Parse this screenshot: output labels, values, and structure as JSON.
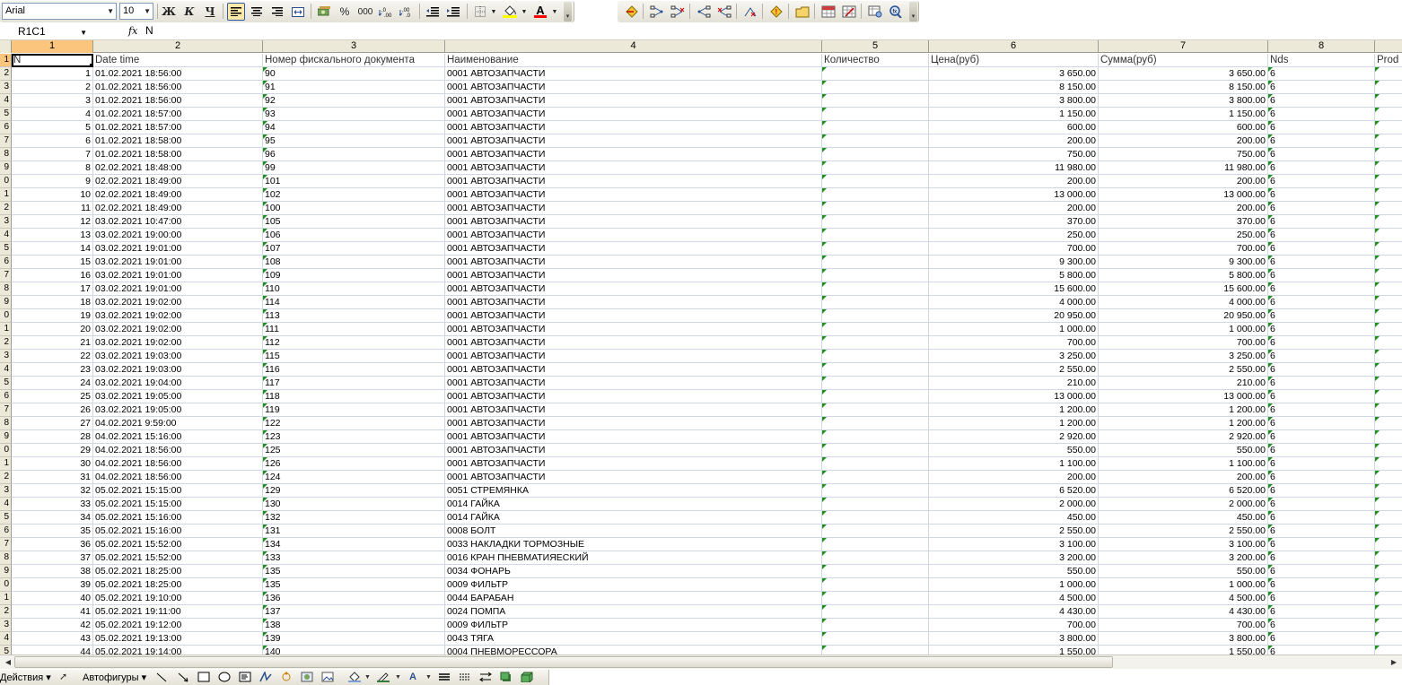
{
  "toolbar": {
    "font_name": "Arial",
    "font_size": "10",
    "bold_label": "Ж",
    "italic_label": "К",
    "underline_label": "Ч",
    "percent_label": "%",
    "thousands_label": "000",
    "font_color_label": "A",
    "icons": [
      "bold",
      "italic",
      "underline",
      "align-left",
      "align-center",
      "align-right",
      "merge-center",
      "currency",
      "percent",
      "thousands",
      "increase-decimal",
      "decrease-decimal",
      "decrease-indent",
      "increase-indent",
      "borders",
      "fill-color",
      "font-color"
    ]
  },
  "formula_bar": {
    "name_box": "R1C1",
    "fx_label": "fx",
    "content": "N"
  },
  "columns": [
    {
      "label": "1",
      "selected": true
    },
    {
      "label": "2"
    },
    {
      "label": "3"
    },
    {
      "label": "4"
    },
    {
      "label": "5"
    },
    {
      "label": "6"
    },
    {
      "label": "7"
    },
    {
      "label": "8"
    },
    {
      "label": ""
    }
  ],
  "header_row": {
    "row_num": "1",
    "cells": [
      "N",
      "Date time",
      "Номер фискального документа",
      "Наименование",
      "Количество",
      "Цена(руб)",
      "Сумма(руб)",
      "Nds",
      "Prod"
    ]
  },
  "rows": [
    {
      "rn": "2",
      "n": "1",
      "dt": "01.02.2021 18:56:00",
      "doc": "90",
      "name": "0001 АВТОЗАПЧАСТИ",
      "price": "3 650.00",
      "sum": "3 650.00",
      "nds": "6"
    },
    {
      "rn": "3",
      "n": "2",
      "dt": "01.02.2021 18:56:00",
      "doc": "91",
      "name": "0001 АВТОЗАПЧАСТИ",
      "price": "8 150.00",
      "sum": "8 150.00",
      "nds": "6"
    },
    {
      "rn": "4",
      "n": "3",
      "dt": "01.02.2021 18:56:00",
      "doc": "92",
      "name": "0001 АВТОЗАПЧАСТИ",
      "price": "3 800.00",
      "sum": "3 800.00",
      "nds": "6"
    },
    {
      "rn": "5",
      "n": "4",
      "dt": "01.02.2021 18:57:00",
      "doc": "93",
      "name": "0001 АВТОЗАПЧАСТИ",
      "price": "1 150.00",
      "sum": "1 150.00",
      "nds": "6"
    },
    {
      "rn": "6",
      "n": "5",
      "dt": "01.02.2021 18:57:00",
      "doc": "94",
      "name": "0001 АВТОЗАПЧАСТИ",
      "price": "600.00",
      "sum": "600.00",
      "nds": "6"
    },
    {
      "rn": "7",
      "n": "6",
      "dt": "01.02.2021 18:58:00",
      "doc": "95",
      "name": "0001 АВТОЗАПЧАСТИ",
      "price": "200.00",
      "sum": "200.00",
      "nds": "6"
    },
    {
      "rn": "8",
      "n": "7",
      "dt": "01.02.2021 18:58:00",
      "doc": "96",
      "name": "0001 АВТОЗАПЧАСТИ",
      "price": "750.00",
      "sum": "750.00",
      "nds": "6"
    },
    {
      "rn": "9",
      "n": "8",
      "dt": "02.02.2021 18:48:00",
      "doc": "99",
      "name": "0001 АВТОЗАПЧАСТИ",
      "price": "11 980.00",
      "sum": "11 980.00",
      "nds": "6"
    },
    {
      "rn": "0",
      "n": "9",
      "dt": "02.02.2021 18:49:00",
      "doc": "101",
      "name": "0001 АВТОЗАПЧАСТИ",
      "price": "200.00",
      "sum": "200.00",
      "nds": "6"
    },
    {
      "rn": "1",
      "n": "10",
      "dt": "02.02.2021 18:49:00",
      "doc": "102",
      "name": "0001 АВТОЗАПЧАСТИ",
      "price": "13 000.00",
      "sum": "13 000.00",
      "nds": "6"
    },
    {
      "rn": "2",
      "n": "11",
      "dt": "02.02.2021 18:49:00",
      "doc": "100",
      "name": "0001 АВТОЗАПЧАСТИ",
      "price": "200.00",
      "sum": "200.00",
      "nds": "6"
    },
    {
      "rn": "3",
      "n": "12",
      "dt": "03.02.2021 10:47:00",
      "doc": "105",
      "name": "0001 АВТОЗАПЧАСТИ",
      "price": "370.00",
      "sum": "370.00",
      "nds": "6"
    },
    {
      "rn": "4",
      "n": "13",
      "dt": "03.02.2021 19:00:00",
      "doc": "106",
      "name": "0001 АВТОЗАПЧАСТИ",
      "price": "250.00",
      "sum": "250.00",
      "nds": "6"
    },
    {
      "rn": "5",
      "n": "14",
      "dt": "03.02.2021 19:01:00",
      "doc": "107",
      "name": "0001 АВТОЗАПЧАСТИ",
      "price": "700.00",
      "sum": "700.00",
      "nds": "6"
    },
    {
      "rn": "6",
      "n": "15",
      "dt": "03.02.2021 19:01:00",
      "doc": "108",
      "name": "0001 АВТОЗАПЧАСТИ",
      "price": "9 300.00",
      "sum": "9 300.00",
      "nds": "6"
    },
    {
      "rn": "7",
      "n": "16",
      "dt": "03.02.2021 19:01:00",
      "doc": "109",
      "name": "0001 АВТОЗАПЧАСТИ",
      "price": "5 800.00",
      "sum": "5 800.00",
      "nds": "6"
    },
    {
      "rn": "8",
      "n": "17",
      "dt": "03.02.2021 19:01:00",
      "doc": "110",
      "name": "0001 АВТОЗАПЧАСТИ",
      "price": "15 600.00",
      "sum": "15 600.00",
      "nds": "6"
    },
    {
      "rn": "9",
      "n": "18",
      "dt": "03.02.2021 19:02:00",
      "doc": "114",
      "name": "0001 АВТОЗАПЧАСТИ",
      "price": "4 000.00",
      "sum": "4 000.00",
      "nds": "6"
    },
    {
      "rn": "0",
      "n": "19",
      "dt": "03.02.2021 19:02:00",
      "doc": "113",
      "name": "0001 АВТОЗАПЧАСТИ",
      "price": "20 950.00",
      "sum": "20 950.00",
      "nds": "6"
    },
    {
      "rn": "1",
      "n": "20",
      "dt": "03.02.2021 19:02:00",
      "doc": "111",
      "name": "0001 АВТОЗАПЧАСТИ",
      "price": "1 000.00",
      "sum": "1 000.00",
      "nds": "6"
    },
    {
      "rn": "2",
      "n": "21",
      "dt": "03.02.2021 19:02:00",
      "doc": "112",
      "name": "0001 АВТОЗАПЧАСТИ",
      "price": "700.00",
      "sum": "700.00",
      "nds": "6"
    },
    {
      "rn": "3",
      "n": "22",
      "dt": "03.02.2021 19:03:00",
      "doc": "115",
      "name": "0001 АВТОЗАПЧАСТИ",
      "price": "3 250.00",
      "sum": "3 250.00",
      "nds": "6"
    },
    {
      "rn": "4",
      "n": "23",
      "dt": "03.02.2021 19:03:00",
      "doc": "116",
      "name": "0001 АВТОЗАПЧАСТИ",
      "price": "2 550.00",
      "sum": "2 550.00",
      "nds": "6"
    },
    {
      "rn": "5",
      "n": "24",
      "dt": "03.02.2021 19:04:00",
      "doc": "117",
      "name": "0001 АВТОЗАПЧАСТИ",
      "price": "210.00",
      "sum": "210.00",
      "nds": "6"
    },
    {
      "rn": "6",
      "n": "25",
      "dt": "03.02.2021 19:05:00",
      "doc": "118",
      "name": "0001 АВТОЗАПЧАСТИ",
      "price": "13 000.00",
      "sum": "13 000.00",
      "nds": "6"
    },
    {
      "rn": "7",
      "n": "26",
      "dt": "03.02.2021 19:05:00",
      "doc": "119",
      "name": "0001 АВТОЗАПЧАСТИ",
      "price": "1 200.00",
      "sum": "1 200.00",
      "nds": "6"
    },
    {
      "rn": "8",
      "n": "27",
      "dt": "04.02.2021 9:59:00",
      "doc": "122",
      "name": "0001 АВТОЗАПЧАСТИ",
      "price": "1 200.00",
      "sum": "1 200.00",
      "nds": "6"
    },
    {
      "rn": "9",
      "n": "28",
      "dt": "04.02.2021 15:16:00",
      "doc": "123",
      "name": "0001 АВТОЗАПЧАСТИ",
      "price": "2 920.00",
      "sum": "2 920.00",
      "nds": "6"
    },
    {
      "rn": "0",
      "n": "29",
      "dt": "04.02.2021 18:56:00",
      "doc": "125",
      "name": "0001 АВТОЗАПЧАСТИ",
      "price": "550.00",
      "sum": "550.00",
      "nds": "6"
    },
    {
      "rn": "1",
      "n": "30",
      "dt": "04.02.2021 18:56:00",
      "doc": "126",
      "name": "0001 АВТОЗАПЧАСТИ",
      "price": "1 100.00",
      "sum": "1 100.00",
      "nds": "6"
    },
    {
      "rn": "2",
      "n": "31",
      "dt": "04.02.2021 18:56:00",
      "doc": "124",
      "name": "0001 АВТОЗАПЧАСТИ",
      "price": "200.00",
      "sum": "200.00",
      "nds": "6"
    },
    {
      "rn": "3",
      "n": "32",
      "dt": "05.02.2021 15:15:00",
      "doc": "129",
      "name": "0051 СТРЕМЯНКА",
      "price": "6 520.00",
      "sum": "6 520.00",
      "nds": "6"
    },
    {
      "rn": "4",
      "n": "33",
      "dt": "05.02.2021 15:15:00",
      "doc": "130",
      "name": "0014 ГАЙКА",
      "price": "2 000.00",
      "sum": "2 000.00",
      "nds": "6"
    },
    {
      "rn": "5",
      "n": "34",
      "dt": "05.02.2021 15:16:00",
      "doc": "132",
      "name": "0014 ГАЙКА",
      "price": "450.00",
      "sum": "450.00",
      "nds": "6"
    },
    {
      "rn": "6",
      "n": "35",
      "dt": "05.02.2021 15:16:00",
      "doc": "131",
      "name": "0008 БОЛТ",
      "price": "2 550.00",
      "sum": "2 550.00",
      "nds": "6"
    },
    {
      "rn": "7",
      "n": "36",
      "dt": "05.02.2021 15:52:00",
      "doc": "134",
      "name": "0033 НАКЛАДКИ ТОРМОЗНЫЕ",
      "price": "3 100.00",
      "sum": "3 100.00",
      "nds": "6"
    },
    {
      "rn": "8",
      "n": "37",
      "dt": "05.02.2021 15:52:00",
      "doc": "133",
      "name": "0016 КРАН ПНЕВМАТИЯЕСКИЙ",
      "price": "3 200.00",
      "sum": "3 200.00",
      "nds": "6"
    },
    {
      "rn": "9",
      "n": "38",
      "dt": "05.02.2021 18:25:00",
      "doc": "135",
      "name": "0034 ФОНАРЬ",
      "price": "550.00",
      "sum": "550.00",
      "nds": "6"
    },
    {
      "rn": "0",
      "n": "39",
      "dt": "05.02.2021 18:25:00",
      "doc": "135",
      "name": "0009 ФИЛЬТР",
      "price": "1 000.00",
      "sum": "1 000.00",
      "nds": "6"
    },
    {
      "rn": "1",
      "n": "40",
      "dt": "05.02.2021 19:10:00",
      "doc": "136",
      "name": "0044 БАРАБАН",
      "price": "4 500.00",
      "sum": "4 500.00",
      "nds": "6"
    },
    {
      "rn": "2",
      "n": "41",
      "dt": "05.02.2021 19:11:00",
      "doc": "137",
      "name": "0024 ПОМПА",
      "price": "4 430.00",
      "sum": "4 430.00",
      "nds": "6"
    },
    {
      "rn": "3",
      "n": "42",
      "dt": "05.02.2021 19:12:00",
      "doc": "138",
      "name": "0009 ФИЛЬТР",
      "price": "700.00",
      "sum": "700.00",
      "nds": "6"
    },
    {
      "rn": "4",
      "n": "43",
      "dt": "05.02.2021 19:13:00",
      "doc": "139",
      "name": "0043 ТЯГА",
      "price": "3 800.00",
      "sum": "3 800.00",
      "nds": "6"
    },
    {
      "rn": "5",
      "n": "44",
      "dt": "05.02.2021 19:14:00",
      "doc": "140",
      "name": "0004 ПНЕВМОРЕССОРА",
      "price": "1 550.00",
      "sum": "1 550.00",
      "nds": "6"
    }
  ],
  "draw_toolbar": {
    "actions_label": "Действия ▾",
    "autoshapes_label": "Автофигуры ▾"
  },
  "colors": {
    "header_bg": "#ece9d8",
    "selected_header": "#fbc57d",
    "gridline": "#d0d7e5",
    "text_marker": "#1f8f1f"
  }
}
